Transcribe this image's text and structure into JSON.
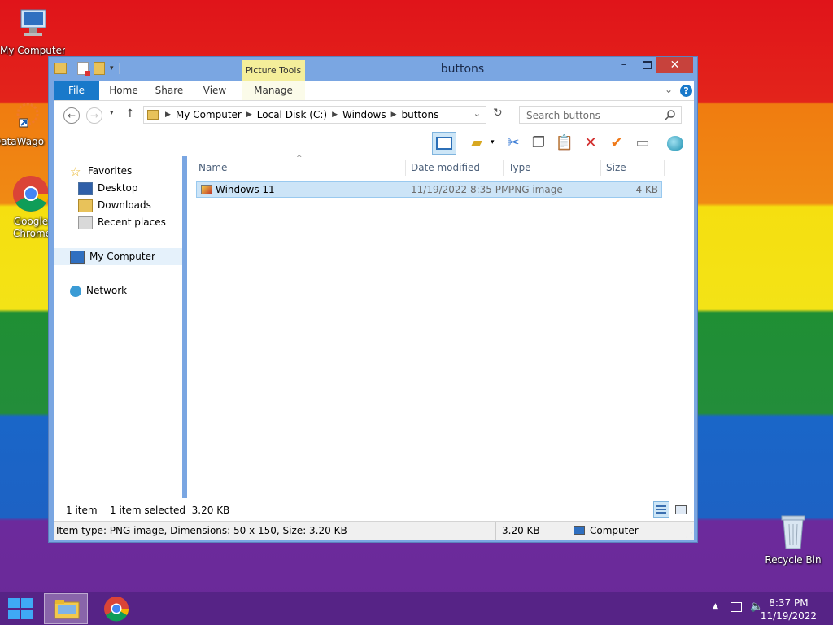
{
  "desktop": {
    "icons": [
      {
        "label": "My Computer"
      },
      {
        "label": "DataWago"
      },
      {
        "label": "Google Chrome"
      },
      {
        "label": "Recycle Bin"
      }
    ]
  },
  "window": {
    "title": "buttons",
    "contextual_tab_group": "Picture Tools",
    "tabs": [
      "File",
      "Home",
      "Share",
      "View",
      "Manage"
    ],
    "breadcrumbs": [
      "My Computer",
      "Local Disk (C:)",
      "Windows",
      "buttons"
    ],
    "search_placeholder": "Search buttons",
    "nav": {
      "favorites": "Favorites",
      "desktop": "Desktop",
      "downloads": "Downloads",
      "recent": "Recent places",
      "my_computer": "My Computer",
      "network": "Network"
    },
    "columns": {
      "name": "Name",
      "date": "Date modified",
      "type": "Type",
      "size": "Size"
    },
    "files": [
      {
        "name": "Windows 11",
        "date": "11/19/2022 8:35 PM",
        "type": "PNG image",
        "size": "4 KB"
      }
    ],
    "status": {
      "count": "1 item",
      "selected": "1 item selected  3.20 KB"
    },
    "details": {
      "info": "Item type: PNG image, Dimensions: 50 x 150, Size: 3.20 KB",
      "size": "3.20 KB",
      "location": "Computer"
    }
  },
  "taskbar": {
    "time": "8:37 PM",
    "date": "11/19/2022"
  },
  "colors": {
    "accent": "#1979ca",
    "selection": "#cce4f7",
    "window_frame": "#7aa6e2",
    "close": "#c7423c"
  }
}
